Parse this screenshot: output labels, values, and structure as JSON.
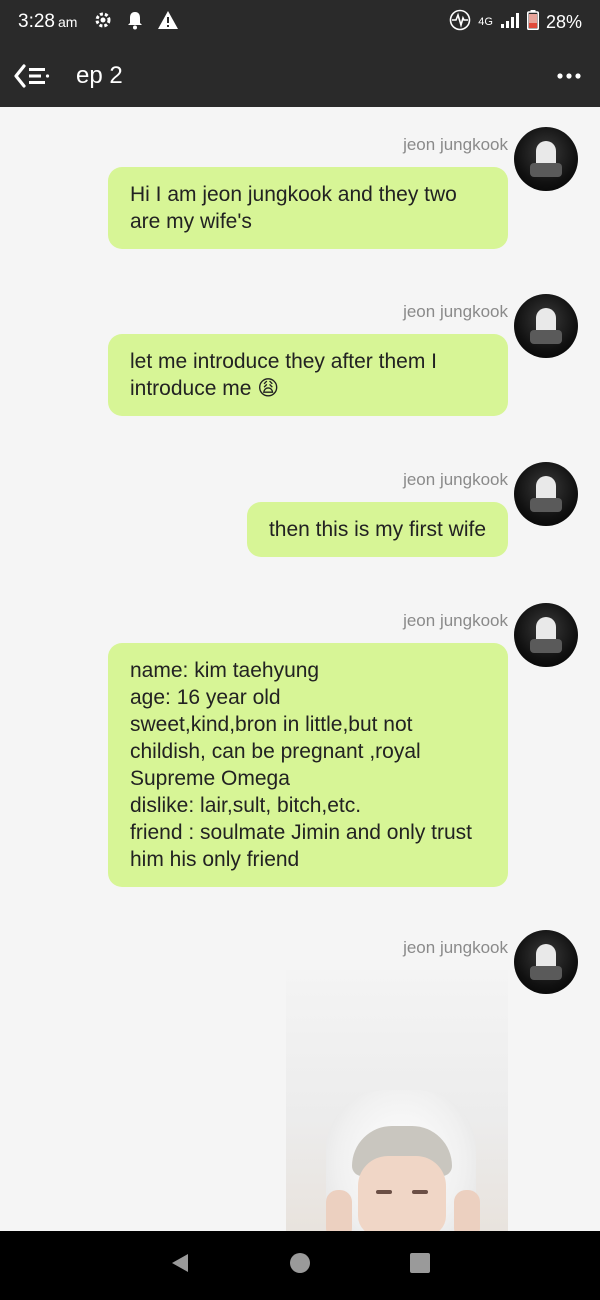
{
  "status_bar": {
    "time": "3:28",
    "ampm": "am",
    "network": "4G",
    "battery": "28%",
    "icons": [
      "settings-icon",
      "notification-bell-icon",
      "warning-icon",
      "activity-icon",
      "signal-icon",
      "battery-icon"
    ]
  },
  "app_bar": {
    "title": "ep 2",
    "icons": [
      "back-menu-icon",
      "more-options-icon"
    ]
  },
  "colors": {
    "bar_bg": "#2a2a2a",
    "bubble_bg": "#d7f596",
    "chat_bg": "#f5f5f5",
    "sender_text": "#8a8a8a"
  },
  "messages": [
    {
      "sender": "jeon jungkook",
      "text": "Hi I am jeon jungkook and they two are my wife's"
    },
    {
      "sender": "jeon jungkook",
      "text": "let me introduce they after them I introduce me 😩"
    },
    {
      "sender": "jeon jungkook",
      "text": "then this is my first wife"
    },
    {
      "sender": "jeon jungkook",
      "text": "name: kim taehyung\nage: 16 year old\nsweet,kind,bron in little,but not childish, can be pregnant ,royal Supreme Omega\ndislike: lair,sult, bitch,etc.\nfriend : soulmate Jimin and only trust him his only friend"
    },
    {
      "sender": "jeon jungkook",
      "type": "image"
    }
  ],
  "nav_bar": {
    "icons": [
      "back-nav-icon",
      "home-nav-icon",
      "recents-nav-icon"
    ]
  }
}
